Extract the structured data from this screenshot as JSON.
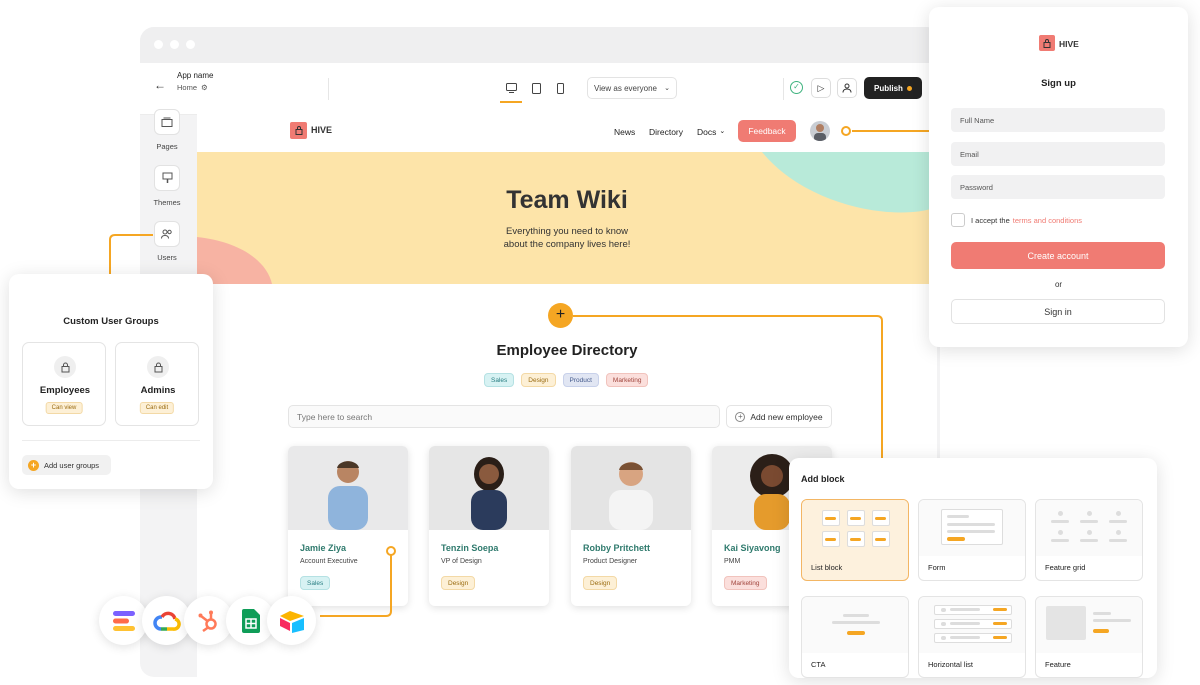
{
  "app": {
    "name": "App name",
    "page": "Home"
  },
  "topbar": {
    "view_select": "View as everyone",
    "publish": "Publish"
  },
  "sidebar": {
    "items": [
      {
        "label": "Pages",
        "icon": "pages-icon"
      },
      {
        "label": "Themes",
        "icon": "themes-icon"
      },
      {
        "label": "Users",
        "icon": "users-icon"
      }
    ]
  },
  "site": {
    "brand": "HIVE",
    "nav": [
      "News",
      "Directory",
      "Docs"
    ],
    "feedback": "Feedback",
    "hero": {
      "title": "Team Wiki",
      "subtitle_line1": "Everything you need to know",
      "subtitle_line2": "about the company lives here!"
    },
    "directory": {
      "title": "Employee Directory",
      "filters": [
        "Sales",
        "Design",
        "Product",
        "Marketing"
      ],
      "search_placeholder": "Type here to search",
      "add_button": "Add new employee",
      "employees": [
        {
          "name": "Jamie Ziya",
          "role": "Account Executive",
          "tag": "Sales"
        },
        {
          "name": "Tenzin Soepa",
          "role": "VP of Design",
          "tag": "Design"
        },
        {
          "name": "Robby Pritchett",
          "role": "Product Designer",
          "tag": "Design"
        },
        {
          "name": "Kai Siyavong",
          "role": "PMM",
          "tag": "Marketing"
        }
      ]
    }
  },
  "groups": {
    "title": "Custom User Groups",
    "items": [
      {
        "name": "Employees",
        "badge": "Can view"
      },
      {
        "name": "Admins",
        "badge": "Can edit"
      }
    ],
    "add": "Add user groups"
  },
  "signup": {
    "brand": "HIVE",
    "title": "Sign up",
    "fields": [
      "Full Name",
      "Email",
      "Password"
    ],
    "accept_prefix": "I accept the",
    "accept_link": "terms and conditions",
    "create": "Create account",
    "or": "or",
    "signin": "Sign in"
  },
  "addblock": {
    "title": "Add block",
    "blocks": [
      "List block",
      "Form",
      "Feature grid",
      "CTA",
      "Horizontal list",
      "Feature"
    ]
  },
  "colors": {
    "accent": "#f5a623",
    "brand": "#f07b73",
    "hero": "#fde4a9",
    "teal": "#b8ead9"
  }
}
